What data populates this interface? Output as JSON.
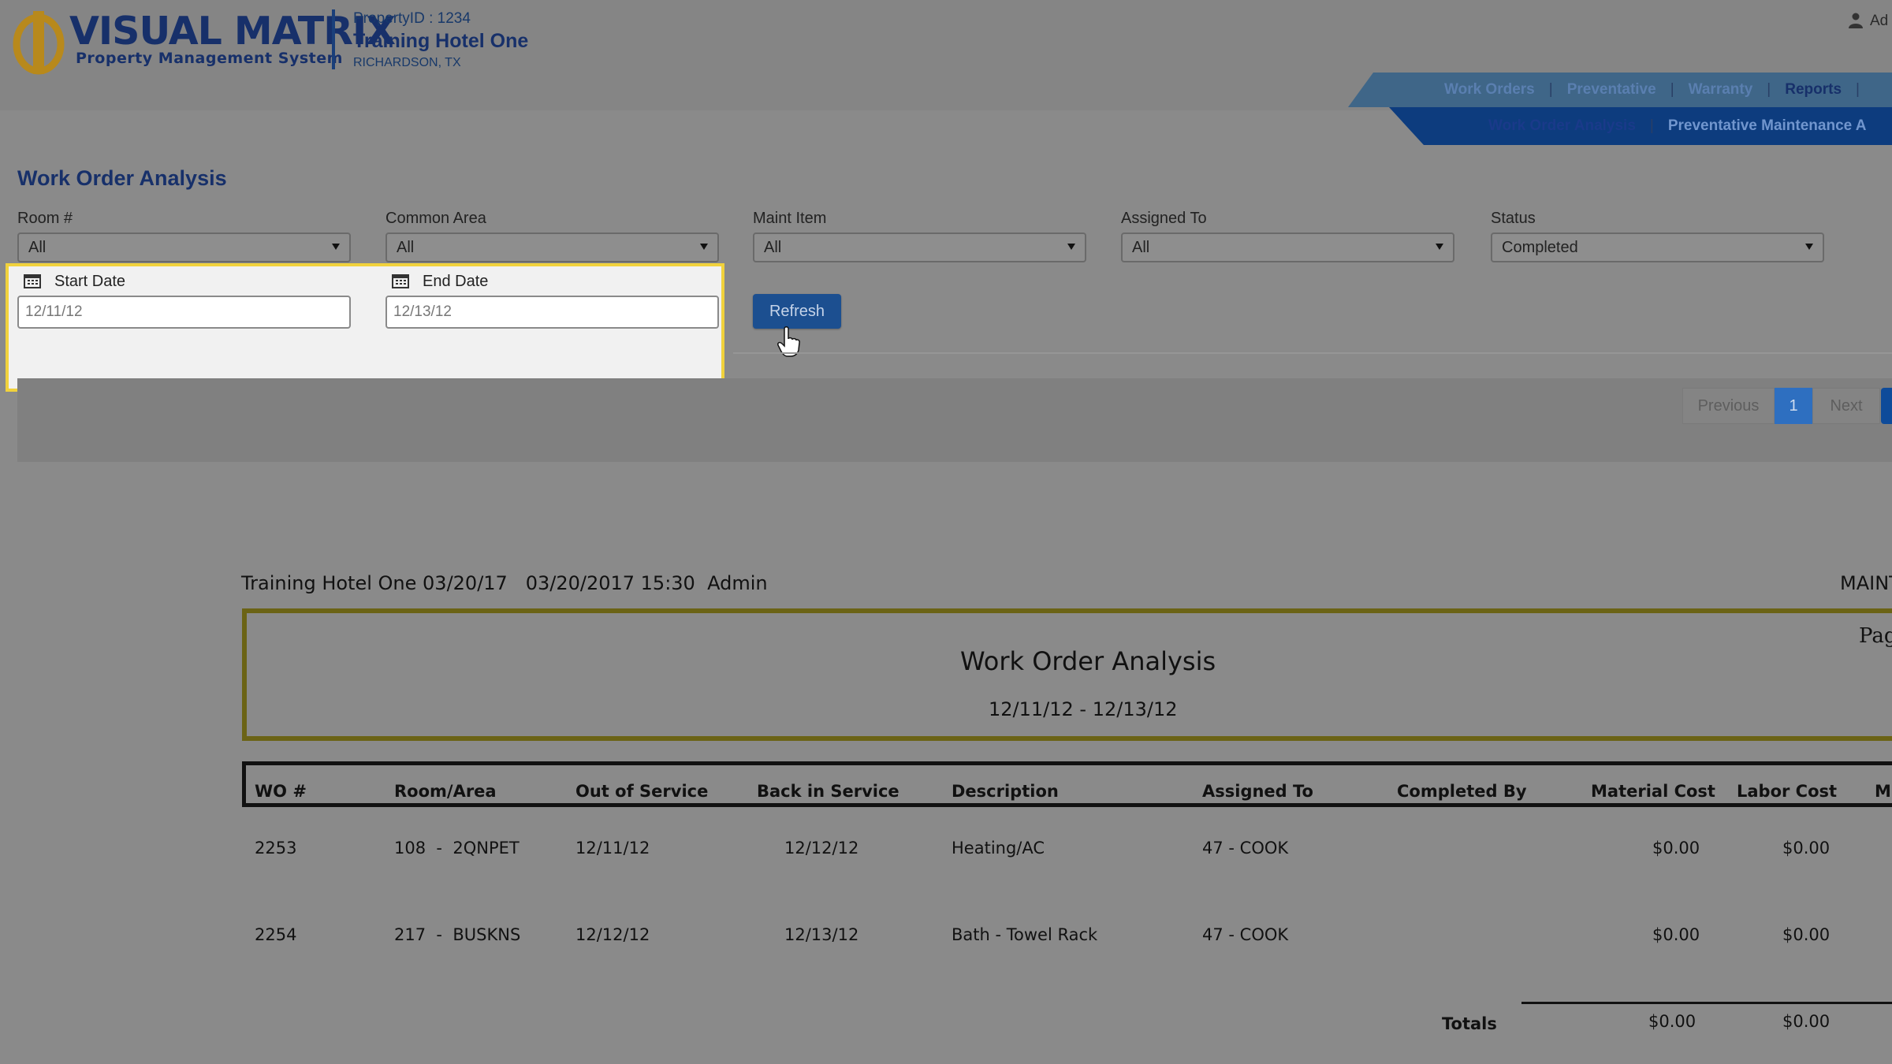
{
  "header": {
    "logo_title": "VISUAL MATRIX",
    "logo_subtitle": "Property Management System",
    "property_id": "PropertyID : 1234",
    "hotel_name": "Training Hotel One",
    "location": "RICHARDSON, TX",
    "user_label": "Ad"
  },
  "nav": {
    "main": [
      "Work Orders",
      "Preventative",
      "Warranty",
      "Reports"
    ],
    "sub": [
      "Work Order Analysis",
      "Preventative Maintenance A"
    ]
  },
  "page": {
    "title": "Work Order Analysis"
  },
  "filters": {
    "room": {
      "label": "Room #",
      "value": "All"
    },
    "common_area": {
      "label": "Common Area",
      "value": "All"
    },
    "maint_item": {
      "label": "Maint Item",
      "value": "All"
    },
    "assigned_to": {
      "label": "Assigned To",
      "value": "All"
    },
    "status": {
      "label": "Status",
      "value": "Completed"
    },
    "start_date": {
      "label": "Start Date",
      "value": "12/11/12"
    },
    "end_date": {
      "label": "End Date",
      "value": "12/13/12"
    },
    "refresh_label": "Refresh"
  },
  "pager": {
    "previous": "Previous",
    "current": "1",
    "next": "Next"
  },
  "report": {
    "header_line": "Training Hotel One 03/20/17   03/20/2017 15:30  Admin",
    "maint_label": "MAINT",
    "title": "Work Order Analysis",
    "date_range": "12/11/12 - 12/13/12",
    "page_label": "Pag",
    "columns": [
      "WO #",
      "Room/Area",
      "Out of Service",
      "Back in Service",
      "Description",
      "Assigned To",
      "Completed By",
      "Material Cost",
      "Labor Cost",
      "Mi"
    ],
    "rows": [
      {
        "wo": "2253",
        "room_area": "108  -  2QNPET",
        "out_of_service": "12/11/12",
        "back_in_service": "12/12/12",
        "description": "Heating/AC",
        "assigned_to": "47 - COOK",
        "completed_by": "",
        "material_cost": "$0.00",
        "labor_cost": "$0.00"
      },
      {
        "wo": "2254",
        "room_area": "217  -  BUSKNS",
        "out_of_service": "12/12/12",
        "back_in_service": "12/13/12",
        "description": "Bath - Towel Rack",
        "assigned_to": "47 - COOK",
        "completed_by": "",
        "material_cost": "$0.00",
        "labor_cost": "$0.00"
      }
    ],
    "totals": {
      "label": "Totals",
      "material_cost": "$0.00",
      "labor_cost": "$0.00"
    }
  },
  "colors": {
    "brand_navy": "#17306a",
    "nav_blue": "#0d3c7e",
    "highlight": "#f1d23c",
    "logo_gold": "#b8891c"
  }
}
